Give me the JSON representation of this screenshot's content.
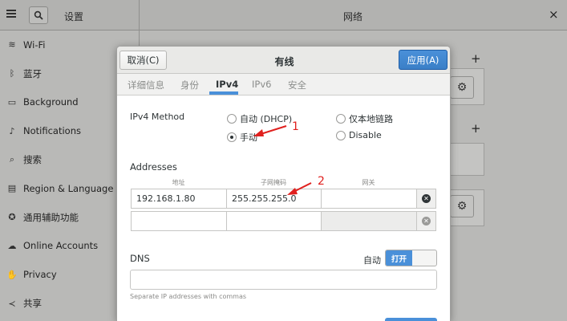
{
  "background": {
    "left_title": "设置",
    "right_title": "网络",
    "close_glyph": "×",
    "sidebar": [
      {
        "label": "Wi-Fi",
        "icon": "wifi-icon",
        "glyph": "≋"
      },
      {
        "label": "蓝牙",
        "icon": "bluetooth-icon",
        "glyph": "ᛒ"
      },
      {
        "label": "Background",
        "icon": "display-icon",
        "glyph": "▭"
      },
      {
        "label": "Notifications",
        "icon": "bell-icon",
        "glyph": "♪"
      },
      {
        "label": "搜索",
        "icon": "search-icon",
        "glyph": "⌕"
      },
      {
        "label": "Region & Language",
        "icon": "keyboard-icon",
        "glyph": "▤"
      },
      {
        "label": "通用辅助功能",
        "icon": "accessibility-icon",
        "glyph": "✪"
      },
      {
        "label": "Online Accounts",
        "icon": "cloud-icon",
        "glyph": "☁"
      },
      {
        "label": "Privacy",
        "icon": "hand-icon",
        "glyph": "✋"
      },
      {
        "label": "共享",
        "icon": "share-icon",
        "glyph": "≺"
      }
    ],
    "plus_glyph": "+",
    "gear_glyph": "⚙"
  },
  "dialog": {
    "cancel_label": "取消(C)",
    "title": "有线",
    "apply_label": "应用(A)",
    "tabs": [
      "详细信息",
      "身份",
      "IPv4",
      "IPv6",
      "安全"
    ],
    "method_label": "IPv4 Method",
    "methods": {
      "dhcp": "自动 (DHCP)",
      "manual": "手动",
      "link_local": "仅本地链路",
      "disable": "Disable"
    },
    "addresses_label": "Addresses",
    "columns": [
      "地址",
      "子网掩码",
      "网关"
    ],
    "rows": [
      {
        "address": "192.168.1.80",
        "netmask": "255.255.255.0",
        "gateway": ""
      },
      {
        "address": "",
        "netmask": "",
        "gateway": ""
      }
    ],
    "dns_label": "DNS",
    "dns_auto_label": "自动",
    "dns_toggle_on": "打开",
    "dns_value": "",
    "dns_hint": "Separate IP addresses with commas"
  },
  "annotations": {
    "n1": "1",
    "n2": "2",
    "color": "#e0201e"
  },
  "colors": {
    "accent": "#4a90d9",
    "annotation": "#e0201e"
  }
}
